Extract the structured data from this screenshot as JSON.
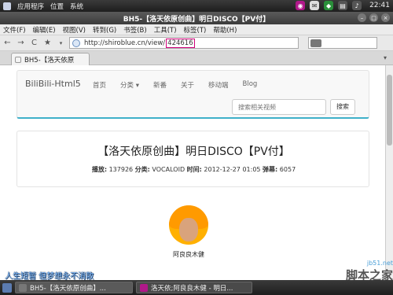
{
  "topbar": {
    "menus": [
      "应用程序",
      "位置",
      "系统"
    ],
    "clock": "22:41"
  },
  "window": {
    "title": "BH5-【洛天依原创曲】明日DISCO【PV付】"
  },
  "menubar": {
    "items": [
      "文件(F)",
      "编辑(E)",
      "视图(V)",
      "转到(G)",
      "书签(B)",
      "工具(T)",
      "标签(T)",
      "帮助(H)"
    ]
  },
  "urlbar": {
    "prefix": "http://shiroblue.cn/view/",
    "highlight": "424616"
  },
  "tab": {
    "label": "BH5-【洛天依原"
  },
  "site": {
    "brand": "BiliBili-Html5",
    "nav": [
      "首页",
      "分类 ▾",
      "新番",
      "关于",
      "移动端",
      "Blog"
    ],
    "search_placeholder": "搜索相关视频",
    "search_button": "搜索"
  },
  "video": {
    "title": "【洛天依原创曲】明日DISCO【PV付】",
    "meta": {
      "plays_label": "播放:",
      "plays": "137926",
      "category_label": "分类:",
      "category": "VOCALOID",
      "time_label": "时间:",
      "time": "2012-12-27 01:05",
      "danmaku_label": "弹幕:",
      "danmaku": "6057"
    }
  },
  "author": {
    "name": "阿良良木健"
  },
  "overlay": {
    "lyric": "人生短暂 但梦想永不消散"
  },
  "watermark": {
    "line1": "jb51.net",
    "line2": "脚本之家"
  },
  "taskbar": {
    "tasks": [
      "BH5-【洛天依原创曲】...",
      "洛天依;阿良良木健 - 明日..."
    ]
  }
}
